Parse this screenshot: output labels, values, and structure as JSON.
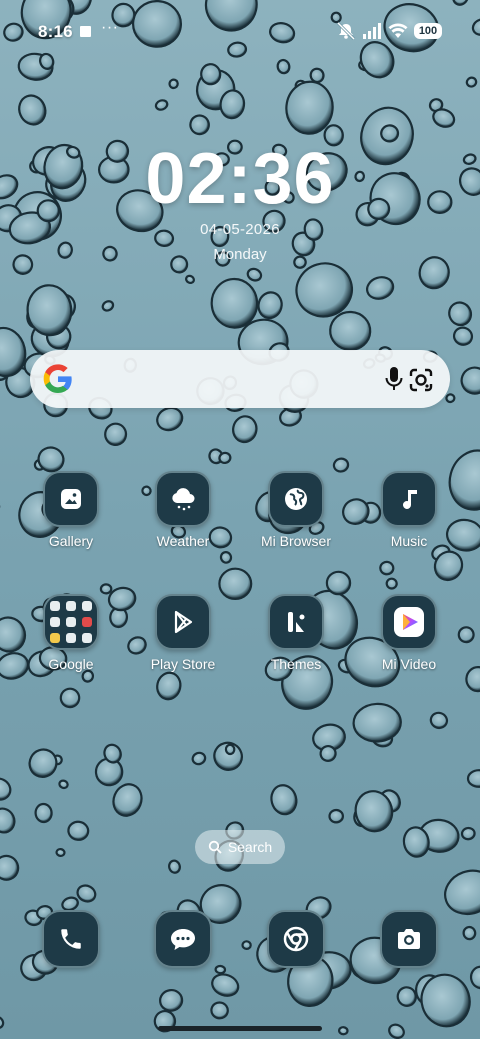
{
  "status_bar": {
    "time": "8:16",
    "dots": "···",
    "battery": "100",
    "icons": [
      "notification-square-icon",
      "dnd-bell-off-icon",
      "signal-icon",
      "wifi-icon",
      "battery-icon"
    ]
  },
  "lockscreen_clock": {
    "time": "02:36",
    "date": "04-05-2026",
    "day": "Monday"
  },
  "search_widget": {
    "icons": [
      "google-logo-icon",
      "microphone-icon",
      "google-lens-icon"
    ]
  },
  "apps": [
    {
      "label": "Gallery",
      "icon": "image-icon"
    },
    {
      "label": "Weather",
      "icon": "cloud-snow-icon"
    },
    {
      "label": "Mi Browser",
      "icon": "globe-icon"
    },
    {
      "label": "Music",
      "icon": "music-note-icon"
    },
    {
      "label": "Google",
      "icon": "folder-icon"
    },
    {
      "label": "Play Store",
      "icon": "play-store-icon"
    },
    {
      "label": "Themes",
      "icon": "themes-icon"
    },
    {
      "label": "Mi Video",
      "icon": "video-play-icon"
    }
  ],
  "app_search": {
    "label": "Search",
    "icon": "search-icon"
  },
  "dock": [
    "phone-icon",
    "messages-icon",
    "chrome-icon",
    "camera-icon"
  ],
  "colors": {
    "wallpaper": "#7fa6b3",
    "icon_background": "#1e3a47",
    "text": "#ffffff"
  }
}
